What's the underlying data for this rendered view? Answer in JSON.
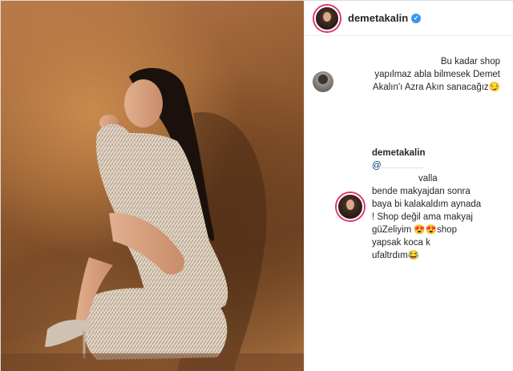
{
  "post": {
    "username": "demetakalin",
    "verified": true,
    "photo_alt": "",
    "comments": [
      {
        "lines": [
          "Bu kadar shop",
          "yapılmaz abla bilmesek Demet",
          "Akalın'ı Azra Akın sanacağız😏"
        ]
      }
    ],
    "reply": {
      "username": "demetakalin",
      "mention": "@",
      "lines": [
        "valla",
        "bende makyajdan sonra",
        "baya bi kalakaldım aynada",
        "! Shop değil ama makyaj",
        "güZeliyim 😍😍shop",
        "yapsak koca k",
        "ufaltrdım😂"
      ]
    }
  },
  "colors": {
    "verified_badge": "#3897f0",
    "story_ring": "#e1306c",
    "mention": "#00376b",
    "text": "#262626"
  },
  "icons": {
    "verified": "verified-check-icon"
  }
}
